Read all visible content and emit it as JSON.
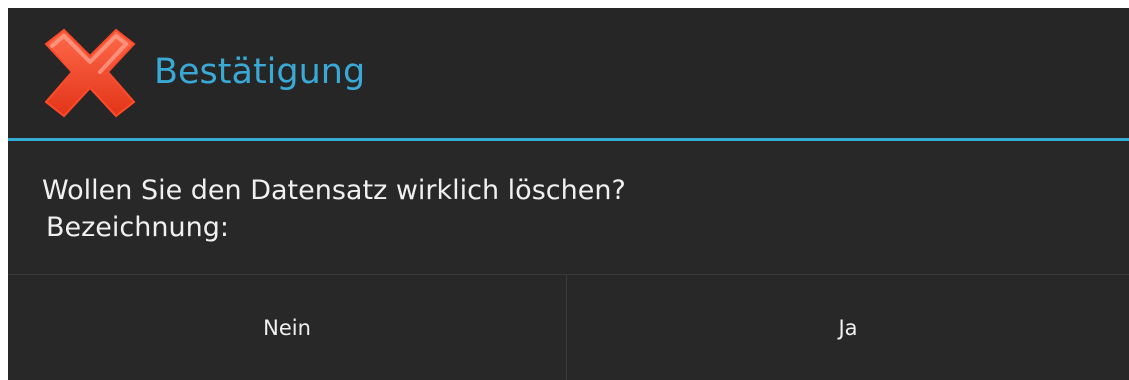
{
  "dialog": {
    "icon": "red-x-icon",
    "title": "Bestätigung",
    "title_color": "#3aa9d6",
    "accent_color": "#35aed6",
    "background_color": "#282828",
    "message_line1": "Wollen Sie den Datensatz wirklich löschen?",
    "message_line2": "Bezeichnung:",
    "buttons": {
      "negative_label": "Nein",
      "positive_label": "Ja"
    }
  }
}
